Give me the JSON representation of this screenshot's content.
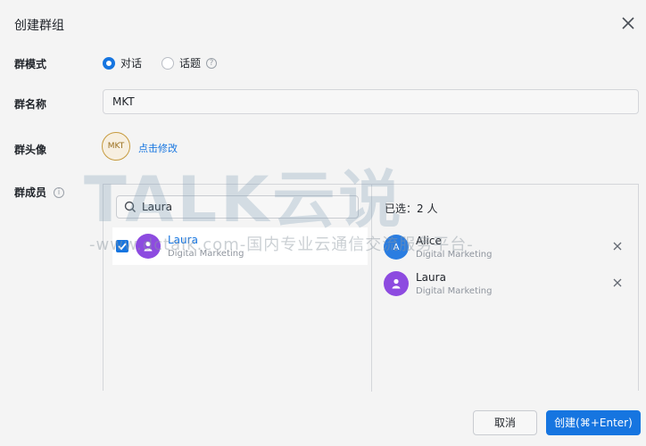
{
  "dialog": {
    "title": "创建群组"
  },
  "mode": {
    "label": "群模式",
    "options": [
      {
        "label": "对话",
        "selected": true
      },
      {
        "label": "话题",
        "selected": false
      }
    ]
  },
  "name": {
    "label": "群名称",
    "value": "MKT"
  },
  "avatar": {
    "label": "群头像",
    "initials": "MKT",
    "change_link": "点击修改"
  },
  "members": {
    "label": "群成员",
    "search_value": "Laura",
    "results": [
      {
        "name": "Laura",
        "dept": "Digital Marketing",
        "checked": true
      }
    ],
    "selected_label": "已选：2 人",
    "selected": [
      {
        "name": "Alice",
        "dept": "Digital Marketing",
        "initial": "A"
      },
      {
        "name": "Laura",
        "dept": "Digital Marketing"
      }
    ]
  },
  "buttons": {
    "cancel": "取消",
    "create": "创建(⌘+Enter)"
  },
  "watermark": {
    "brand": "TALK云说",
    "url": "-www.dctalk.com-国内专业云通信交流服务平台-"
  },
  "colors": {
    "accent": "#1675e0",
    "avatar_purple": "#8d4be0",
    "avatar_blue": "#2a7de1"
  }
}
